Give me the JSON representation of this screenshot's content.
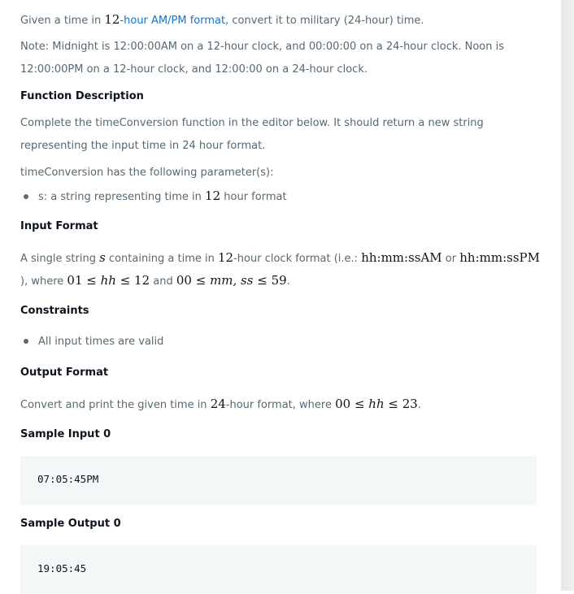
{
  "intro": {
    "pre": "Given a time in ",
    "num": "12",
    "link": "-hour AM/PM format",
    "post": ", convert it to military (24-hour) time."
  },
  "note": {
    "line1": "Note: Midnight is 12:00:00AM on a 12-hour clock, and 00:00:00 on a 24-hour clock. Noon is",
    "line2": "12:00:00PM on a 12-hour clock, and 12:00:00 on a 24-hour clock."
  },
  "function_description": {
    "heading": "Function Description",
    "line1": "Complete the timeConversion function in the editor below. It should return a new string",
    "line2": "representing the input time in 24 hour format.",
    "params_label": "timeConversion has the following parameter(s):",
    "param_pre": "s: a string representing time in ",
    "param_num": "12",
    "param_post": " hour format"
  },
  "input_format": {
    "heading": "Input Format",
    "a": "A single string ",
    "s": "s",
    "b": " containing a time in ",
    "n12": "12",
    "c": "-hour clock format (i.e.: ",
    "f1": "hh:mm:ssAM",
    "or": " or ",
    "f2": "hh:mm:ssPM",
    "d": "), where ",
    "m1": "01 ≤ ",
    "hh": "hh",
    "m2": " ≤ 12",
    "and": " and ",
    "m3": "00 ≤ ",
    "mmss": "mm, ss",
    "m4": " ≤ 59",
    "end": "."
  },
  "constraints": {
    "heading": "Constraints",
    "item": "All input times are valid"
  },
  "output_format": {
    "heading": "Output Format",
    "pre": "Convert and print the given time in ",
    "n24": "24",
    "mid": "-hour format, where ",
    "m1": "00 ≤ ",
    "hh": "hh",
    "m2": " ≤ 23",
    "end": "."
  },
  "sample_input": {
    "heading": "Sample Input 0",
    "code": "07:05:45PM"
  },
  "sample_output": {
    "heading": "Sample Output 0",
    "code": "19:05:45"
  }
}
